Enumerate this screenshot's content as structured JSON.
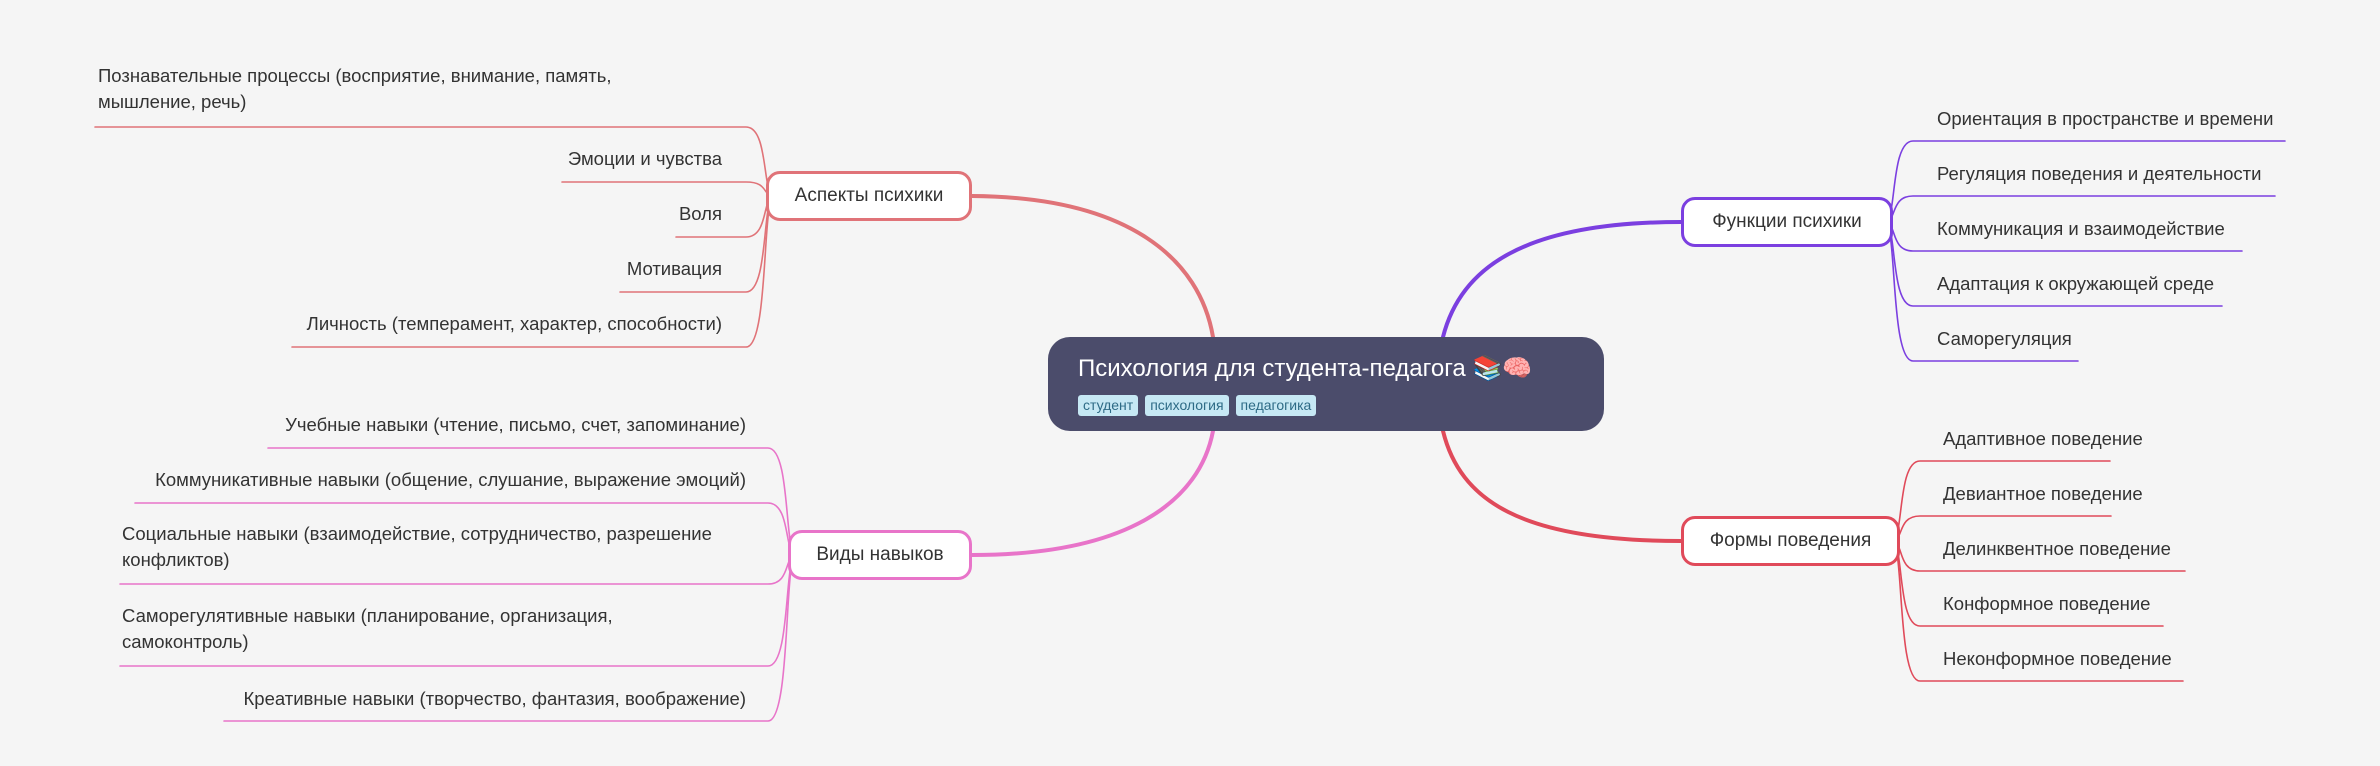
{
  "root": {
    "title": "Психология для студента-педагога 📚🧠",
    "tags": [
      "студент",
      "психология",
      "педагогика"
    ]
  },
  "colors": {
    "aspects": "#e07378",
    "skills": "#e874c9",
    "functions": "#7b3fe0",
    "behavior": "#e04a5a",
    "root_bg": "#4b4c6b"
  },
  "branches": {
    "aspects": {
      "label": "Аспекты психики",
      "items": [
        "Познавательные процессы (восприятие, внимание, память,\nмышление, речь)",
        "Эмоции и чувства",
        "Воля",
        "Мотивация",
        "Личность (темперамент, характер, способности)"
      ]
    },
    "skills": {
      "label": "Виды навыков",
      "items": [
        "Учебные навыки (чтение, письмо, счет, запоминание)",
        "Коммуникативные навыки (общение, слушание, выражение эмоций)",
        "Социальные навыки (взаимодействие, сотрудничество, разрешение\nконфликтов)",
        "Саморегулятивные навыки (планирование, организация,\nсамоконтроль)",
        "Креативные навыки (творчество, фантазия, воображение)"
      ]
    },
    "functions": {
      "label": "Функции психики",
      "items": [
        "Ориентация в пространстве и времени",
        "Регуляция поведения и деятельности",
        "Коммуникация и взаимодействие",
        "Адаптация к окружающей среде",
        "Саморегуляция"
      ]
    },
    "behavior": {
      "label": "Формы поведения",
      "items": [
        "Адаптивное поведение",
        "Девиантное поведение",
        "Делинквентное поведение",
        "Конформное поведение",
        "Неконформное поведение"
      ]
    }
  }
}
